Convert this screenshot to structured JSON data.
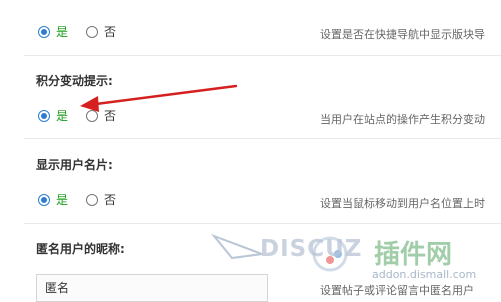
{
  "rows": [
    {
      "title": "",
      "yes": "是",
      "no": "否",
      "desc": "设置是否在快捷导航中显示版块导",
      "selected": "yes"
    },
    {
      "title": "积分变动提示:",
      "yes": "是",
      "no": "否",
      "desc": "当用户在站点的操作产生积分变动",
      "selected": "yes"
    },
    {
      "title": "显示用户名片:",
      "yes": "是",
      "no": "否",
      "desc": "设置当鼠标移动到用户名位置上时",
      "selected": "yes"
    }
  ],
  "anonymous": {
    "title": "匿名用户的昵称:",
    "value": "匿名",
    "desc": "设置帖子或评论留言中匿名用户"
  },
  "watermark": {
    "brand": "DISCUZ",
    "cn": "插件网",
    "url": "addon.dismall.com"
  },
  "colors": {
    "accent": "#2d7dd2",
    "yes_label": "#1a9b1a",
    "arrow": "#d62020"
  }
}
